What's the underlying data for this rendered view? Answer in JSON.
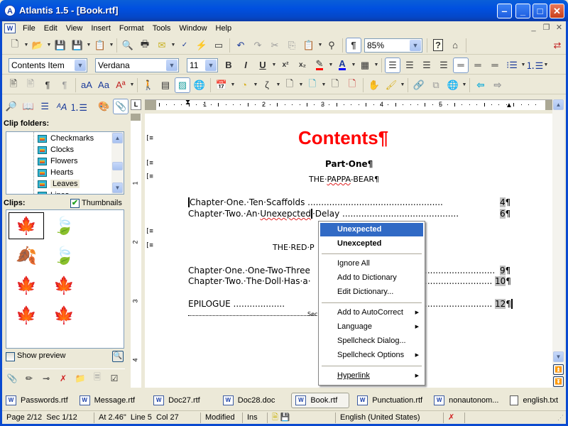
{
  "window": {
    "title": "Atlantis 1.5 - [Book.rtf]",
    "app_icon": "A",
    "buttons": {
      "minimize_tray": "‒",
      "minimize": "_",
      "maximize": "□",
      "close": "✕"
    }
  },
  "menubar": {
    "items": [
      "File",
      "Edit",
      "View",
      "Insert",
      "Format",
      "Tools",
      "Window",
      "Help"
    ],
    "mdi_buttons": {
      "minimize": "_",
      "restore": "❐",
      "close": "✕"
    }
  },
  "toolbar_standard": {
    "zoom_value": "85%"
  },
  "toolbar_format": {
    "style_value": "Contents Item",
    "font_value": "Verdana",
    "size_value": "11",
    "bold": "B",
    "italic": "I",
    "underline": "U",
    "superscript": "x²",
    "subscript": "x₂",
    "highlight_color": "#ff0000",
    "font_color": "#0000ff"
  },
  "left_panel": {
    "clip_folders_label": "Clip folders:",
    "folders": [
      "Checkmarks",
      "Clocks",
      "Flowers",
      "Hearts",
      "Leaves",
      "Lines"
    ],
    "selected_folder": "Leaves",
    "clips_label": "Clips:",
    "thumbnails_label": "Thumbnails",
    "thumbnails_checked": true,
    "show_preview_label": "Show preview",
    "show_preview_checked": false,
    "clips": [
      {
        "name": "maple-leaf-tan",
        "glyph": "🍁",
        "color": "#a07820"
      },
      {
        "name": "green-leaf",
        "glyph": "🍃",
        "color": "#6aaa2a"
      },
      {
        "name": "orange-leaf",
        "glyph": "🍂",
        "color": "#e88a10"
      },
      {
        "name": "gray-green-leaf",
        "glyph": "🍃",
        "color": "#6a9a6a"
      },
      {
        "name": "brown-maple-leaf",
        "glyph": "🍁",
        "color": "#8a5010"
      },
      {
        "name": "yellow-leaf",
        "glyph": "🍁",
        "color": "#e8c020"
      },
      {
        "name": "red-maple-leaf",
        "glyph": "🍁",
        "color": "#b02020"
      },
      {
        "name": "orange-maple-leaf",
        "glyph": "🍁",
        "color": "#d86020"
      }
    ]
  },
  "ruler": {
    "corner": "L",
    "numbers": [
      "1",
      "2",
      "3",
      "4",
      "5"
    ],
    "vnumbers": [
      "1",
      "2",
      "3",
      "4"
    ]
  },
  "document": {
    "title": "Contents¶",
    "part_one": "Part·One¶",
    "pappa_bear_pre": "THE·",
    "pappa_bear_err": "PAPPA",
    "pappa_bear_post": "-BEAR¶",
    "ch1_text": "Chapter·One.·Ten·Scaffolds",
    "ch1_page": "4",
    "ch2_pre": "Chapter·Two.·An·",
    "ch2_err": "Unexepcted",
    "ch2_post": "·Delay",
    "ch2_page": "6",
    "red_heading": "THE·RED·P",
    "ch3_text": "Chapter·One.·One-Two-Three",
    "ch3_page": "9",
    "ch4_text": "Chapter·Two.·The·Doll·Has·a·",
    "ch4_page": "10",
    "epilogue": "EPILOGUE",
    "epilogue_page": "12",
    "pilcrow": "¶",
    "section_break": "Sec",
    "title_color": "#ff0000"
  },
  "context_menu": {
    "suggestions": [
      "Unexpected",
      "Unexcepted"
    ],
    "highlighted": "Unexpected",
    "group1": [
      "Ignore All",
      "Add to Dictionary",
      "Edit Dictionary..."
    ],
    "group2": [
      {
        "label": "Add to AutoCorrect",
        "submenu": true
      },
      {
        "label": "Language",
        "submenu": true
      },
      {
        "label": "Spellcheck Dialog...",
        "submenu": false
      },
      {
        "label": "Spellcheck Options",
        "submenu": true
      }
    ],
    "hyperlink": "Hyperlink",
    "submenu_arrow": "▶"
  },
  "doc_tabs": [
    {
      "label": "Passwords.rtf",
      "icon": "word"
    },
    {
      "label": "Message.rtf",
      "icon": "word"
    },
    {
      "label": "Doc27.rtf",
      "icon": "word"
    },
    {
      "label": "Doc28.doc",
      "icon": "word"
    },
    {
      "label": "Book.rtf",
      "icon": "word",
      "active": true
    },
    {
      "label": "Punctuation.rtf",
      "icon": "word"
    },
    {
      "label": "nonautonom...",
      "icon": "word"
    },
    {
      "label": "english.txt",
      "icon": "text"
    }
  ],
  "statusbar": {
    "page": "Page 2/12",
    "section": "Sec 1/12",
    "position": "At 2.46\"",
    "line": "Line 5",
    "col": "Col 27",
    "modified": "Modified",
    "mode": "Ins",
    "language": "English (United States)"
  }
}
